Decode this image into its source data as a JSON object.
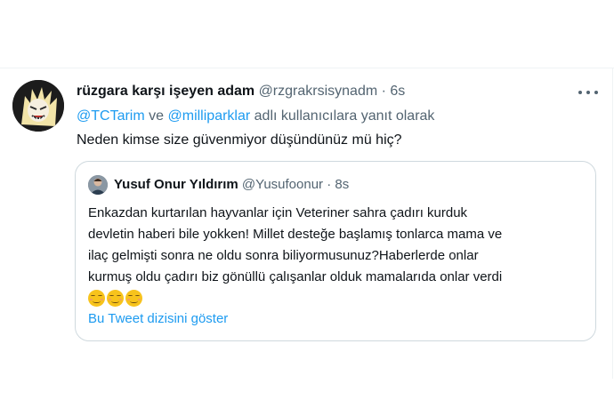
{
  "tweet": {
    "display_name": "rüzgara karşı işeyen adam",
    "handle": "@rzgrakrsisynadm",
    "separator": "·",
    "time": "6s",
    "reply_mention_1": "@TCTarim",
    "reply_connector": "ve",
    "reply_mention_2": "@milliparklar",
    "reply_suffix": "adlı kullanıcılara yanıt olarak",
    "text": "Neden kimse size güvenmiyor düşündünüz mü hiç?",
    "more_icon": "more-horizontal-icon"
  },
  "quoted": {
    "display_name": "Yusuf Onur Yıldırım",
    "handle": "@Yusufoonur",
    "separator": "·",
    "time": "8s",
    "lines": [
      "Enkazdan kurtarılan hayvanlar için Veteriner sahra çadırı kurduk",
      "devletin haberi bile yokken! Millet desteğe başlamış tonlarca mama ve",
      "ilaç gelmişti sonra ne oldu sonra biliyormusunuz?Haberlerde onlar",
      "kurmuş oldu çadırı biz gönüllü çalışanlar olduk mamalarıda onlar verdi"
    ],
    "emoji_count": 3,
    "emoji": "relieved-face-emoji",
    "show_thread": "Bu Tweet dizisini göster"
  },
  "colors": {
    "link": "#1d9bf0",
    "secondary_text": "#536471",
    "primary_text": "#0f1419",
    "border": "#cfd9de"
  }
}
